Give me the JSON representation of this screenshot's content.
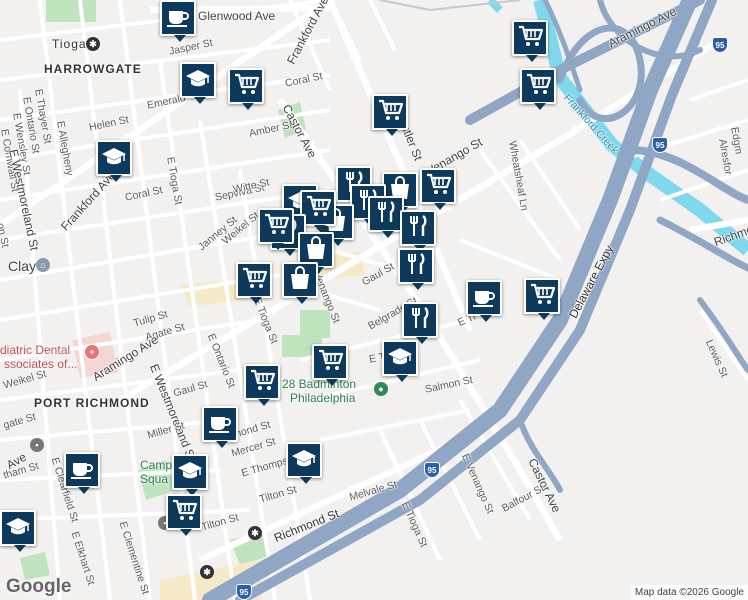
{
  "map": {
    "areas": [
      {
        "name": "tioga",
        "text": "Tioga"
      },
      {
        "name": "harrowgate",
        "text": "HARROWGATE"
      },
      {
        "name": "port-richmond",
        "text": "PORT RICHMOND"
      }
    ],
    "streets": [
      {
        "id": "glenwood-ave",
        "text": "Glenwood Ave"
      },
      {
        "id": "frankford-ave-top",
        "text": "Frankford Ave"
      },
      {
        "id": "aramingo-ave-top",
        "text": "Aramingo Ave"
      },
      {
        "id": "jasper-st",
        "text": "Jasper St"
      },
      {
        "id": "coral-st-top",
        "text": "Coral St"
      },
      {
        "id": "emerald-st",
        "text": "Emerald"
      },
      {
        "id": "e-ontario-st-left",
        "text": "E Ontario St"
      },
      {
        "id": "e-thayer-st",
        "text": "E Thayer St"
      },
      {
        "id": "e-wensley-st",
        "text": "E Wensley St"
      },
      {
        "id": "e-cornwall-st",
        "text": "E Cornwall St"
      },
      {
        "id": "e-allegheny-st",
        "text": "E Allegheny"
      },
      {
        "id": "helen-st",
        "text": "Helen St"
      },
      {
        "id": "amber-st",
        "text": "Amber St"
      },
      {
        "id": "castor-ave-top",
        "text": "Castor Ave"
      },
      {
        "id": "cutler-st",
        "text": "Cutler St"
      },
      {
        "id": "venango-st-top",
        "text": "Venango St"
      },
      {
        "id": "wheatsheaf-ln",
        "text": "Wheatsheaf Ln"
      },
      {
        "id": "frankford-creek",
        "text": "Frankford Creek"
      },
      {
        "id": "edgemont-st",
        "text": "Edgm"
      },
      {
        "id": "alresford-st",
        "text": "Alresfor"
      },
      {
        "id": "westmoreland-st",
        "text": "E Westmoreland St"
      },
      {
        "id": "frankford-ave-mid",
        "text": "Frankford Ave"
      },
      {
        "id": "coral-st-mid",
        "text": "Coral St"
      },
      {
        "id": "e-tioga-st-top",
        "text": "E Tioga St"
      },
      {
        "id": "sepviva-st",
        "text": "Sepviva St"
      },
      {
        "id": "witte-st",
        "text": "Witte St"
      },
      {
        "id": "jasper-st-mid",
        "text": "Janney St"
      },
      {
        "id": "weikel-st-mid",
        "text": "Weikel St"
      },
      {
        "id": "tulip-st",
        "text": "Tulip St"
      },
      {
        "id": "agate-st",
        "text": "Agate St"
      },
      {
        "id": "e-tioga-st-mid",
        "text": "E Tioga St"
      },
      {
        "id": "venango-st-mid",
        "text": "Venango St"
      },
      {
        "id": "gaul-st-mid",
        "text": "Gaul St"
      },
      {
        "id": "belgrade-st",
        "text": "Belgrade St"
      },
      {
        "id": "e-tioga-st-right",
        "text": "E Ti"
      },
      {
        "id": "richmond-st-right",
        "text": "Richmond"
      },
      {
        "id": "delaware-expy",
        "text": "Delaware Expy"
      },
      {
        "id": "lewis-st",
        "text": "Lewis St"
      },
      {
        "id": "aramingo-ave-mid",
        "text": "Aramingo Ave"
      },
      {
        "id": "e-ontario-st-mid",
        "text": "E Ontario St"
      },
      {
        "id": "e-westmoreland-st-low",
        "text": "E Westmoreland St"
      },
      {
        "id": "gaul-st-low",
        "text": "Gaul St"
      },
      {
        "id": "miller-st",
        "text": "Miller St"
      },
      {
        "id": "almond-st",
        "text": "Almond St"
      },
      {
        "id": "mercer-st",
        "text": "Mercer St"
      },
      {
        "id": "e-thompson-st",
        "text": "E Thompson St"
      },
      {
        "id": "salmon-st",
        "text": "Salmon St"
      },
      {
        "id": "tilton-st-mid",
        "text": "Tilton St"
      },
      {
        "id": "richmond-st-low",
        "text": "Richmond St"
      },
      {
        "id": "melvale-st",
        "text": "Melvale St"
      },
      {
        "id": "e-venango-st-low",
        "text": "E Venango St"
      },
      {
        "id": "castor-ave-low",
        "text": "Castor Ave"
      },
      {
        "id": "balfour-st",
        "text": "Balfour St"
      },
      {
        "id": "e-tioga-st-low",
        "text": "E Tioga St"
      },
      {
        "id": "tilton-st-low",
        "text": "Tilton St"
      },
      {
        "id": "e-clementine-st",
        "text": "E Clementine St"
      },
      {
        "id": "e-elkhart-st",
        "text": "E Elkhart St"
      },
      {
        "id": "e-clearfield-st",
        "text": "E Clearfield St"
      },
      {
        "id": "e-cheltenham-st",
        "text": "tham St"
      },
      {
        "id": "weikel-st-left",
        "text": "Weikel St"
      },
      {
        "id": "ave-left",
        "text": "Ave"
      },
      {
        "id": "aramingo-left",
        "text": "gate St"
      },
      {
        "id": "on-st-left",
        "text": "on St"
      },
      {
        "id": "clay-label",
        "text": "Clay"
      },
      {
        "id": "e-t-st",
        "text": "E T"
      }
    ],
    "pois": [
      {
        "id": "dental",
        "text": "diatric Dental"
      },
      {
        "id": "dental2",
        "text": "ssociates of..."
      },
      {
        "id": "badminton1",
        "text": "28 Badminton"
      },
      {
        "id": "badminton2",
        "text": "Philadelphia"
      },
      {
        "id": "campbell1",
        "text": "Camp"
      },
      {
        "id": "campbell2",
        "text": "Squa"
      }
    ],
    "shields": [
      {
        "id": "i95-top",
        "text": "95"
      },
      {
        "id": "i95-mid",
        "text": "95"
      },
      {
        "id": "i95-low",
        "text": "95"
      },
      {
        "id": "i95-bottom",
        "text": "95"
      }
    ],
    "markers": [
      {
        "type": "cafe",
        "icon": "coffee-cup-icon"
      },
      {
        "type": "grocery",
        "icon": "shopping-cart-icon"
      },
      {
        "type": "grocery",
        "icon": "shopping-cart-icon"
      },
      {
        "type": "school",
        "icon": "graduation-cap-icon"
      },
      {
        "type": "grocery",
        "icon": "shopping-cart-icon"
      },
      {
        "type": "grocery",
        "icon": "shopping-cart-icon"
      },
      {
        "type": "school",
        "icon": "graduation-cap-icon"
      },
      {
        "type": "school",
        "icon": "graduation-cap-icon"
      },
      {
        "type": "restaurant",
        "icon": "fork-knife-icon"
      },
      {
        "type": "shopping",
        "icon": "shopping-bag-icon"
      },
      {
        "type": "grocery",
        "icon": "shopping-cart-icon"
      },
      {
        "type": "restaurant",
        "icon": "fork-knife-icon"
      },
      {
        "type": "restaurant",
        "icon": "fork-knife-icon"
      },
      {
        "type": "shopping",
        "icon": "shopping-bag-icon"
      },
      {
        "type": "grocery",
        "icon": "shopping-cart-icon"
      },
      {
        "type": "restaurant",
        "icon": "fork-knife-icon"
      },
      {
        "type": "restaurant",
        "icon": "fork-knife-icon"
      },
      {
        "type": "shopping",
        "icon": "shopping-bag-icon"
      },
      {
        "type": "grocery",
        "icon": "shopping-cart-icon"
      },
      {
        "type": "cafe",
        "icon": "coffee-cup-icon"
      },
      {
        "type": "grocery",
        "icon": "shopping-cart-icon"
      },
      {
        "type": "restaurant",
        "icon": "fork-knife-icon"
      },
      {
        "type": "grocery",
        "icon": "shopping-cart-icon"
      },
      {
        "type": "school",
        "icon": "graduation-cap-icon"
      },
      {
        "type": "grocery",
        "icon": "shopping-cart-icon"
      },
      {
        "type": "cafe",
        "icon": "coffee-cup-icon"
      },
      {
        "type": "school",
        "icon": "graduation-cap-icon"
      },
      {
        "type": "cafe",
        "icon": "coffee-cup-icon"
      },
      {
        "type": "school",
        "icon": "graduation-cap-icon"
      },
      {
        "type": "grocery",
        "icon": "shopping-cart-icon"
      },
      {
        "type": "school",
        "icon": "graduation-cap-icon"
      },
      {
        "type": "grocery",
        "icon": "shopping-cart-icon"
      },
      {
        "type": "shopping",
        "icon": "shopping-bag-icon"
      },
      {
        "type": "restaurant",
        "icon": "fork-knife-icon"
      }
    ],
    "attribution": "Map data ©2026 Google",
    "logo": "Google",
    "colors": {
      "marker": "#0d3a5c",
      "highway": "#8fa6c4",
      "water": "#7fd8ec",
      "park": "#b9dfb8",
      "road": "#ffffff"
    }
  }
}
